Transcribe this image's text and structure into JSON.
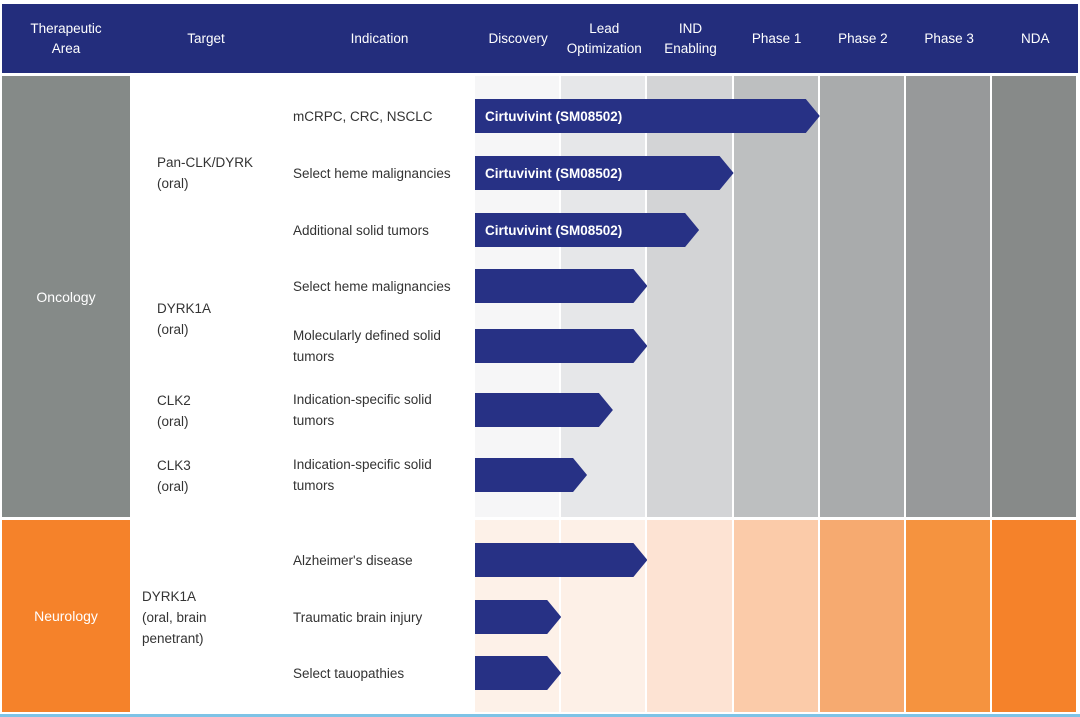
{
  "header": [
    "Therapeutic\nArea",
    "Target",
    "Indication",
    "Discovery",
    "Lead\nOptimization",
    "IND\nEnabling",
    "Phase 1",
    "Phase 2",
    "Phase 3",
    "NDA"
  ],
  "colors": {
    "header": "#232d7c",
    "bar": "#273185",
    "oncology": "#858a88",
    "neurology": "#f5822a",
    "oncology_stages": [
      "#f6f6f7",
      "#e6e7e9",
      "#d3d4d6",
      "#bdbfc0",
      "#a9abac",
      "#97999a",
      "#878a89"
    ],
    "neurology_stages": [
      "#fdf1e8",
      "#fdf0e7",
      "#fde3d3",
      "#fbcba9",
      "#f6aa70",
      "#f5933f",
      "#f5822a"
    ]
  },
  "chart_data": {
    "type": "bar",
    "title": "Development pipeline",
    "stages": [
      "Discovery",
      "Lead Optimization",
      "IND Enabling",
      "Phase 1",
      "Phase 2",
      "Phase 3",
      "NDA"
    ],
    "xunit": "stages completed (Discovery = 1)",
    "xlim": [
      0,
      7
    ],
    "areas": [
      {
        "name": "Oncology",
        "targets": [
          {
            "name": "Pan-CLK/DYRK\n(oral)",
            "rows": [
              {
                "indication": "mCRPC, CRC, NSCLC",
                "drug": "Cirtuvivint (SM08502)",
                "progress": 4.0
              },
              {
                "indication": "Select heme malignancies",
                "drug": "Cirtuvivint (SM08502)",
                "progress": 3.0
              },
              {
                "indication": "Additional solid tumors",
                "drug": "Cirtuvivint (SM08502)",
                "progress": 2.6
              }
            ]
          },
          {
            "name": "DYRK1A\n(oral)",
            "rows": [
              {
                "indication": "Select heme malignancies",
                "drug": "",
                "progress": 2.0
              },
              {
                "indication": "Molecularly defined solid\ntumors",
                "drug": "",
                "progress": 2.0
              }
            ]
          },
          {
            "name": "CLK2\n(oral)",
            "rows": [
              {
                "indication": "Indication-specific solid\ntumors",
                "drug": "",
                "progress": 1.6
              }
            ]
          },
          {
            "name": "CLK3\n(oral)",
            "rows": [
              {
                "indication": "Indication-specific solid\ntumors",
                "drug": "",
                "progress": 1.3
              }
            ]
          }
        ]
      },
      {
        "name": "Neurology",
        "targets": [
          {
            "name": "DYRK1A\n(oral, brain\npenetrant)",
            "rows": [
              {
                "indication": "Alzheimer's disease",
                "drug": "",
                "progress": 2.0
              },
              {
                "indication": "Traumatic brain injury",
                "drug": "",
                "progress": 1.0
              },
              {
                "indication": "Select tauopathies",
                "drug": "",
                "progress": 1.0
              }
            ]
          }
        ]
      }
    ]
  }
}
